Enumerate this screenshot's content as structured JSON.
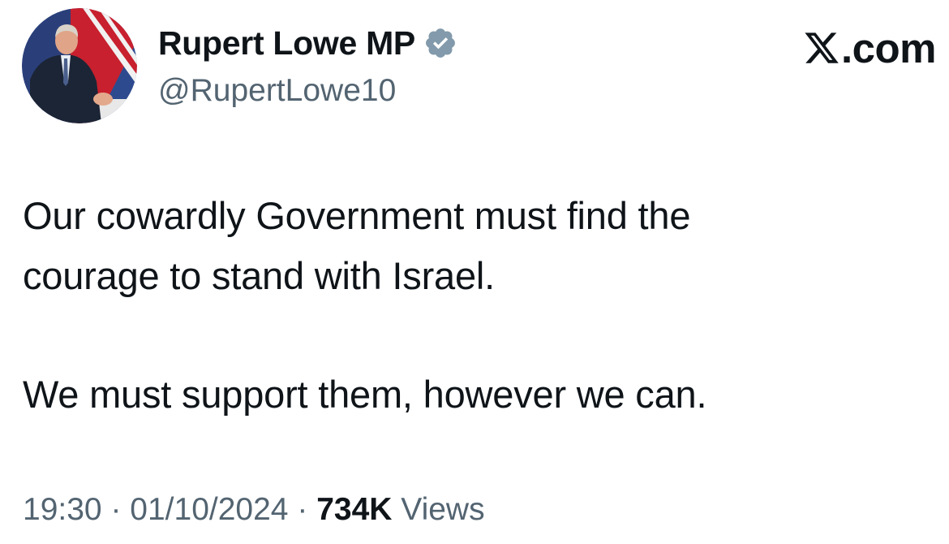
{
  "author": {
    "display_name": "Rupert Lowe MP",
    "handle": "@RupertLowe10",
    "verified": true,
    "verified_badge_color": "#829aab"
  },
  "brand": {
    "icon": "x-logo-icon",
    "text": ".com"
  },
  "tweet": {
    "lines": [
      "Our cowardly Government must find the",
      "courage to stand with Israel.",
      "We must support them, however we can."
    ]
  },
  "meta": {
    "time": "19:30",
    "separator": "·",
    "date": "01/10/2024",
    "views_count": "734K",
    "views_label": "Views"
  },
  "colors": {
    "text_primary": "#0f1419",
    "text_secondary": "#536471",
    "background": "#ffffff"
  }
}
